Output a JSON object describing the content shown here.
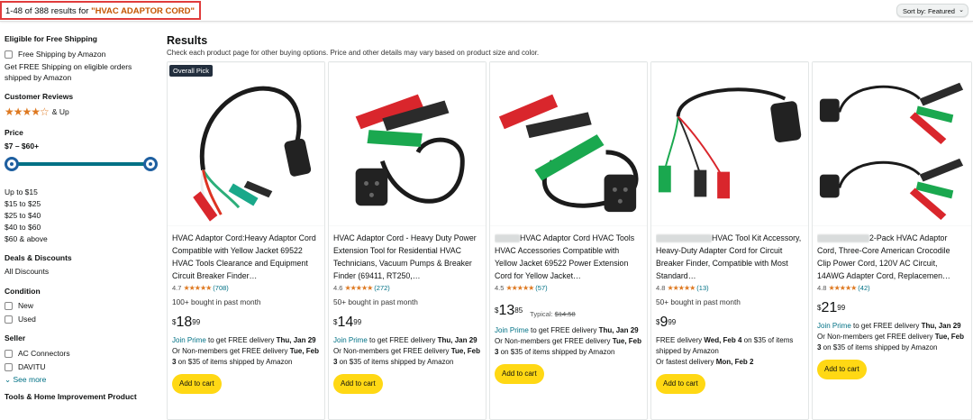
{
  "results_bar": {
    "count_text": "1-48 of 388 results for ",
    "query": "\"HVAC ADAPTOR CORD\"",
    "sort_label": "Sort by:",
    "sort_value": "Featured"
  },
  "sidebar": {
    "free_shipping": {
      "heading": "Eligible for Free Shipping",
      "checkbox_label": "Free Shipping by Amazon",
      "note": "Get FREE Shipping on eligible orders shipped by Amazon"
    },
    "reviews": {
      "heading": "Customer Reviews",
      "stars": "★★★★☆",
      "label": "& Up"
    },
    "price": {
      "heading": "Price",
      "range": "$7 – $60+",
      "min_fraction": 0,
      "max_fraction": 1,
      "links": [
        "Up to $15",
        "$15 to $25",
        "$25 to $40",
        "$40 to $60",
        "$60 & above"
      ]
    },
    "deals": {
      "heading": "Deals & Discounts",
      "link": "All Discounts"
    },
    "condition": {
      "heading": "Condition",
      "options": [
        "New",
        "Used"
      ]
    },
    "seller": {
      "heading": "Seller",
      "options": [
        "AC Connectors",
        "DAVITU"
      ],
      "see_more": "See more"
    },
    "next_heading": "Tools & Home Improvement Product"
  },
  "main": {
    "heading": "Results",
    "subheading": "Check each product page for other buying options. Price and other details may vary based on product size and color.",
    "badge": "Overall Pick",
    "products": [
      {
        "title": "HVAC Adaptor Cord:Heavy Adaptor Cord Compatible with Yellow Jacket 69522 HVAC Tools Clearance and Equipment Circuit Breaker Finder…",
        "rating": "4.7",
        "stars": "★★★★★",
        "count": "(708)",
        "bought": "100+ bought in past month",
        "price_sym": "$",
        "price_dollars": "18",
        "price_cents": "99",
        "prime_link": "Join Prime",
        "prime_text": " to get FREE delivery ",
        "prime_date": "Thu, Jan 29",
        "nonmember_text": "Or Non-members get FREE delivery ",
        "nonmember_date": "Tue, Feb 3",
        "nonmember_tail": " on $35 of items shipped by Amazon",
        "cart": "Add to cart"
      },
      {
        "title": "HVAC Adaptor Cord - Heavy Duty Power Extension Tool for Residential HVAC Technicians, Vacuum Pumps & Breaker Finder (69411, RT250,…",
        "rating": "4.6",
        "stars": "★★★★★",
        "count": "(272)",
        "bought": "50+ bought in past month",
        "price_sym": "$",
        "price_dollars": "14",
        "price_cents": "99",
        "prime_link": "Join Prime",
        "prime_text": " to get FREE delivery ",
        "prime_date": "Thu, Jan 29",
        "nonmember_text": "Or Non-members get FREE delivery ",
        "nonmember_date": "Tue, Feb 3",
        "nonmember_tail": " on $35 of items shipped by Amazon",
        "cart": "Add to cart"
      },
      {
        "title": "HVAC Adaptor Cord HVAC Tools HVAC Accessories Compatible with Yellow Jacket 69522 Power Extension Cord for Yellow Jacket…",
        "rating": "4.5",
        "stars": "★★★★★",
        "count": "(57)",
        "price_sym": "$",
        "price_dollars": "13",
        "price_cents": "85",
        "typical_label": "Typical:",
        "typical_price": "$14.58",
        "prime_link": "Join Prime",
        "prime_text": " to get FREE delivery ",
        "prime_date": "Thu, Jan 29",
        "nonmember_text": "Or Non-members get FREE delivery ",
        "nonmember_date": "Tue, Feb 3",
        "nonmember_tail": " on $35 of items shipped by Amazon",
        "cart": "Add to cart"
      },
      {
        "title": "HVAC Tool Kit Accessory, Heavy-Duty Adapter Cord for Circuit Breaker Finder, Compatible with Most Standard…",
        "rating": "4.8",
        "stars": "★★★★★",
        "count": "(13)",
        "bought": "50+ bought in past month",
        "price_sym": "$",
        "price_dollars": "9",
        "price_cents": "99",
        "delivery_text": "FREE delivery ",
        "delivery_date": "Wed, Feb 4",
        "delivery_tail": " on $35 of items shipped by Amazon",
        "fastest_text": "Or fastest delivery ",
        "fastest_date": "Mon, Feb 2",
        "cart": "Add to cart"
      },
      {
        "title": "2-Pack HVAC Adaptor Cord, Three-Core American Crocodile Clip Power Cord, 120V AC Circuit, 14AWG Adapter Cord, Replacemen…",
        "rating": "4.8",
        "stars": "★★★★★",
        "count": "(42)",
        "price_sym": "$",
        "price_dollars": "21",
        "price_cents": "99",
        "prime_link": "Join Prime",
        "prime_text": " to get FREE delivery ",
        "prime_date": "Thu, Jan 29",
        "nonmember_text": "Or Non-members get FREE delivery ",
        "nonmember_date": "Tue, Feb 3",
        "nonmember_tail": " on $35 of items shipped by Amazon",
        "cart": "Add to cart"
      }
    ]
  },
  "colors": {
    "link": "#007185",
    "star": "#de7921",
    "cart": "#ffd814",
    "clip_red": "#d9262c",
    "clip_green": "#1aa84f",
    "clip_black": "#2b2b2b",
    "query": "#c45500"
  }
}
